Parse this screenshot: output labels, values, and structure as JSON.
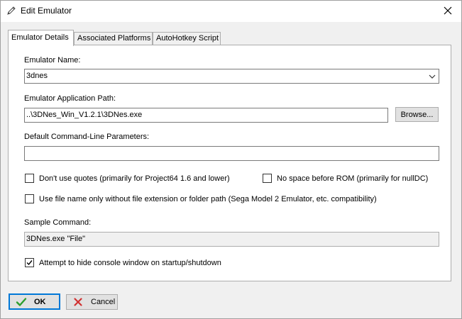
{
  "window": {
    "title": "Edit Emulator",
    "icon": "pencil-icon",
    "close_icon": "close-icon"
  },
  "tabs": [
    {
      "label": "Emulator Details",
      "active": true
    },
    {
      "label": "Associated Platforms",
      "active": false
    },
    {
      "label": "AutoHotkey Script",
      "active": false
    }
  ],
  "form": {
    "emulator_name_label": "Emulator Name:",
    "emulator_name_value": "3dnes",
    "app_path_label": "Emulator Application Path:",
    "app_path_value": "..\\3DNes_Win_V1.2.1\\3DNes.exe",
    "browse_label": "Browse...",
    "cmdline_label": "Default Command-Line Parameters:",
    "cmdline_value": "",
    "chk_no_quotes": {
      "label": "Don't use quotes (primarily for Project64 1.6 and lower)",
      "checked": false
    },
    "chk_no_space": {
      "label": "No space before ROM (primarily for nullDC)",
      "checked": false
    },
    "chk_filename_only": {
      "label": "Use file name only without file extension or folder path (Sega Model 2 Emulator, etc. compatibility)",
      "checked": false
    },
    "sample_label": "Sample Command:",
    "sample_value": "3DNes.exe \"File\"",
    "chk_hide_console": {
      "label": "Attempt to hide console window on startup/shutdown",
      "checked": true
    }
  },
  "footer": {
    "ok_label": "OK",
    "cancel_label": "Cancel",
    "ok_icon": "checkmark-icon",
    "cancel_icon": "cancel-x-icon"
  },
  "colors": {
    "ok_check": "#2e9e2e",
    "cancel_x": "#d03030",
    "default_border": "#0078d7"
  }
}
